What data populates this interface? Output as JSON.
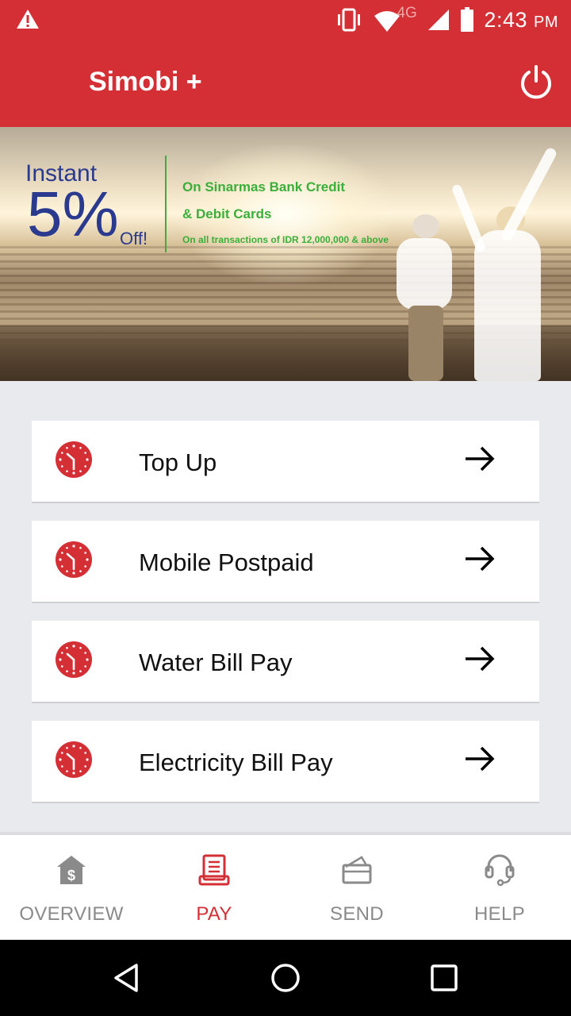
{
  "status_bar": {
    "time": "2:43",
    "ampm": "PM",
    "network_label": "4G",
    "icons": [
      "warning-icon",
      "vibrate-icon",
      "wifi-icon",
      "signal-icon",
      "battery-icon"
    ]
  },
  "app_bar": {
    "title": "Simobi +",
    "power_icon": "power-icon"
  },
  "banner": {
    "instant": "Instant",
    "percent": "5%",
    "off": "Off!",
    "line1": "On Sinarmas Bank Credit",
    "line2": "& Debit Cards",
    "note": "On all transactions of IDR 12,000,000 & above"
  },
  "menu": {
    "items": [
      {
        "label": "Top Up",
        "icon": "clock-icon"
      },
      {
        "label": "Mobile Postpaid",
        "icon": "clock-icon"
      },
      {
        "label": "Water Bill Pay",
        "icon": "clock-icon"
      },
      {
        "label": "Electricity Bill Pay",
        "icon": "clock-icon"
      }
    ]
  },
  "bottom_nav": {
    "items": [
      {
        "label": "OVERVIEW",
        "icon": "home-dollar-icon",
        "active": false
      },
      {
        "label": "PAY",
        "icon": "receipt-icon",
        "active": true
      },
      {
        "label": "SEND",
        "icon": "wallet-icon",
        "active": false
      },
      {
        "label": "HELP",
        "icon": "headset-icon",
        "active": false
      }
    ]
  },
  "colors": {
    "brand_red": "#d32f35",
    "promo_blue": "#2a3a8f",
    "promo_green": "#3cae3a",
    "nav_inactive": "#8a8a8a"
  }
}
